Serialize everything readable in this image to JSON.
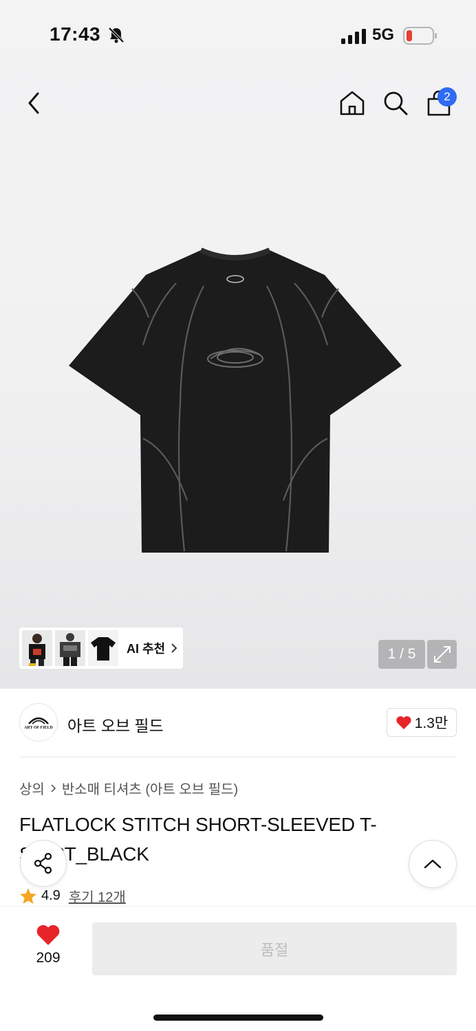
{
  "status_bar": {
    "time": "17:43",
    "network": "5G",
    "battery_color": "#e5412f"
  },
  "nav": {
    "back_icon": "chevron-left-icon",
    "home_icon": "home-icon",
    "search_icon": "search-icon",
    "cart_icon": "shopping-bag-icon",
    "cart_count": "2",
    "badge_color": "#2f6bf2"
  },
  "gallery": {
    "ai_label": "AI 추천",
    "counter": "1 / 5",
    "expand_icon": "expand-icon"
  },
  "brand": {
    "name": "아트 오브 필드",
    "logo_text": "ART OF FIELD",
    "likes": "1.3만"
  },
  "product": {
    "breadcrumb": [
      "상의",
      "반소매 티셔츠 (아트 오브 필드)"
    ],
    "title": "FLATLOCK STITCH SHORT-SLEEVED T-SHIRT_BLACK",
    "rating": "4.9",
    "review_label": "후기 12개"
  },
  "actions": {
    "share_icon": "share-icon",
    "scroll_top_icon": "chevron-up-icon",
    "wish_count": "209",
    "buy_label": "품절",
    "heart_color": "#e8242b"
  }
}
